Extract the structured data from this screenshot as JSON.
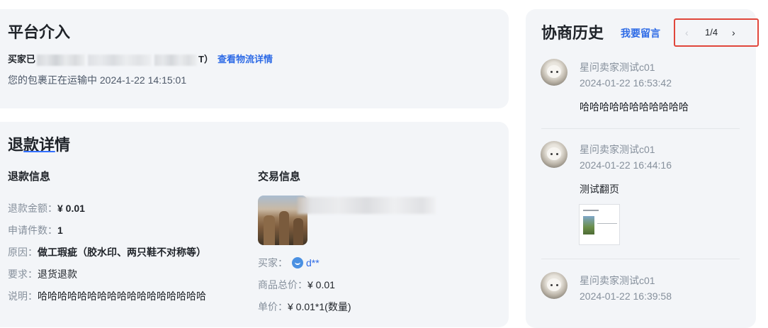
{
  "platform": {
    "title": "平台介入",
    "logistics_prefix": "买家已",
    "logistics_suffix": "T）",
    "logistics_link": "查看物流详情",
    "package_status": "您的包裹正在运输中 2024-1-22 14:15:01"
  },
  "refund": {
    "title": "退款详情",
    "refund_info": {
      "title": "退款信息",
      "rows": [
        {
          "label": "退款金额：",
          "value": "¥ 0.01"
        },
        {
          "label": "申请件数：",
          "value": "1"
        },
        {
          "label": "原因：",
          "value": "做工瑕疵（胶水印、两只鞋不对称等）"
        },
        {
          "label": "要求：",
          "value": "退货退款"
        },
        {
          "label": "说明：",
          "value": "哈哈哈哈哈哈哈哈哈哈哈哈哈哈哈哈哈"
        }
      ]
    },
    "trade_info": {
      "title": "交易信息",
      "buyer_label": "买家：",
      "buyer_name": "d**",
      "total_label": "商品总价：",
      "total_value": "¥ 0.01",
      "unit_label": "单价：",
      "unit_value": "¥ 0.01*1(数量)"
    }
  },
  "history": {
    "title": "协商历史",
    "leave_message": "我要留言",
    "pager": {
      "prev": "‹",
      "text": "1/4",
      "next": "›"
    },
    "messages": [
      {
        "sender": "星问卖家测试c01",
        "time": "2024-01-22 16:53:42",
        "text": "哈哈哈哈哈哈哈哈哈哈哈"
      },
      {
        "sender": "星问卖家测试c01",
        "time": "2024-01-22 16:44:16",
        "text": "测试翻页"
      },
      {
        "sender": "星问卖家测试c01",
        "time": "2024-01-22 16:39:58",
        "text": ""
      }
    ]
  },
  "colors": {
    "accent": "#2e6be6",
    "card_bg": "#f3f5f8",
    "highlight_border": "#e0463b"
  }
}
